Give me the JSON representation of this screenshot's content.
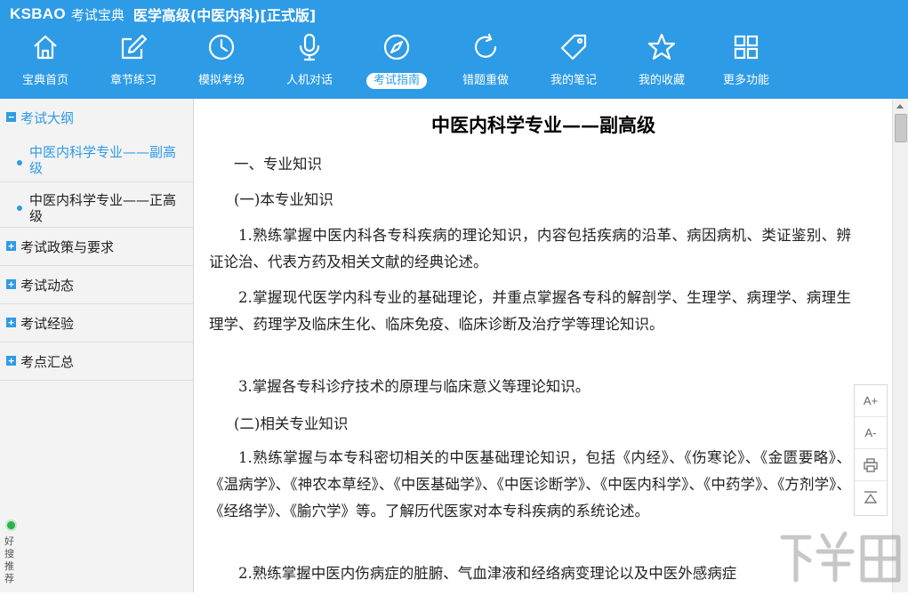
{
  "brand": {
    "logo": "KSBAO",
    "name": "考试宝典",
    "title": "医学高级(中医内科)[正式版]"
  },
  "nav": [
    {
      "label": "宝典首页",
      "icon": "home-icon"
    },
    {
      "label": "章节练习",
      "icon": "edit-icon"
    },
    {
      "label": "模拟考场",
      "icon": "clock-icon"
    },
    {
      "label": "人机对话",
      "icon": "microphone-icon"
    },
    {
      "label": "考试指南",
      "icon": "compass-icon",
      "active": true
    },
    {
      "label": "错题重做",
      "icon": "refresh-icon"
    },
    {
      "label": "我的笔记",
      "icon": "tag-icon"
    },
    {
      "label": "我的收藏",
      "icon": "star-icon"
    },
    {
      "label": "更多功能",
      "icon": "grid-icon"
    }
  ],
  "sidebar": {
    "sections": [
      {
        "label": "考试大纲",
        "expanded": true
      },
      {
        "label": "考试政策与要求",
        "expanded": false
      },
      {
        "label": "考试动态",
        "expanded": false
      },
      {
        "label": "考试经验",
        "expanded": false
      },
      {
        "label": "考点汇总",
        "expanded": false
      }
    ],
    "sub_items": [
      {
        "label": "中医内科学专业——副高级",
        "active": true
      },
      {
        "label": "中医内科学专业——正高级",
        "active": false
      }
    ],
    "expand_symbol": "+",
    "collapse_symbol": "−",
    "recommend_label": "好搜推荐"
  },
  "doc": {
    "title": "中医内科学专业——副高级",
    "h1": "一、专业知识",
    "h2a": "(一)本专业知识",
    "p1": "1.熟练掌握中医内科各专科疾病的理论知识，内容包括疾病的沿革、病因病机、类证鉴别、辨证论治、代表方药及相关文献的经典论述。",
    "p2": "2.掌握现代医学内科专业的基础理论，并重点掌握各专科的解剖学、生理学、病理学、病理生理学、药理学及临床生化、临床免疫、临床诊断及治疗学等理论知识。",
    "p3": "3.掌握各专科诊疗技术的原理与临床意义等理论知识。",
    "h2b": "(二)相关专业知识",
    "p4": "1.熟练掌握与本专科密切相关的中医基础理论知识，包括《内经》、《伤寒论》、《金匮要略》、《温病学》、《神农本草经》、《中医基础学》、《中医诊断学》、《中医内科学》、《中药学》、《方剂学》、《经络学》、《腧穴学》等。了解历代医家对本专科疾病的系统论述。",
    "p5": "2.熟练掌握中医内伤病症的脏腑、气血津液和经络病变理论以及中医外感病症"
  },
  "tools": {
    "font_increase": "A+",
    "font_decrease": "A-"
  },
  "watermark": "下载吧",
  "colors": {
    "accent": "#2e9be6",
    "sidebar_bg": "#f3f3f3"
  }
}
